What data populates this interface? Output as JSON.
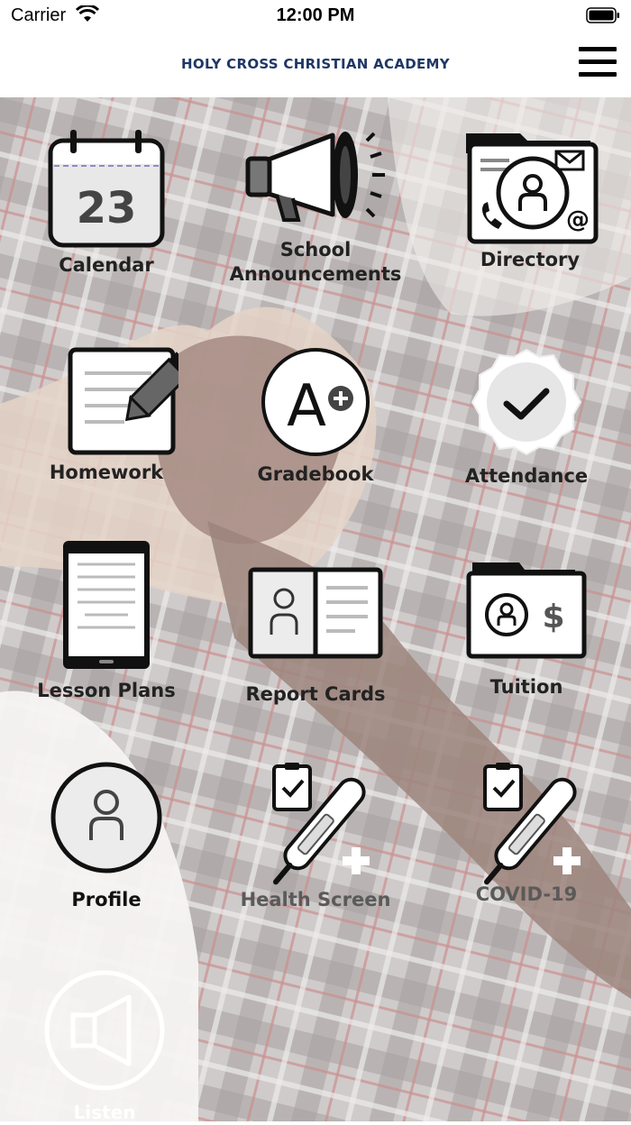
{
  "status_bar": {
    "carrier": "Carrier",
    "time": "12:00 PM"
  },
  "header": {
    "title": "HOLY CROSS CHRISTIAN ACADEMY"
  },
  "tiles": [
    {
      "label": "Calendar",
      "icon": "calendar-icon",
      "calendar_day": "23"
    },
    {
      "label": "School\nAnnouncements",
      "icon": "megaphone-icon"
    },
    {
      "label": "Directory",
      "icon": "directory-card-icon"
    },
    {
      "label": "Homework",
      "icon": "homework-icon"
    },
    {
      "label": "Gradebook",
      "icon": "grade-a-plus-icon",
      "grade_text": "A"
    },
    {
      "label": "Attendance",
      "icon": "checkmark-badge-icon"
    },
    {
      "label": "Lesson Plans",
      "icon": "tablet-icon"
    },
    {
      "label": "Report Cards",
      "icon": "report-book-icon"
    },
    {
      "label": "Tuition",
      "icon": "tuition-folder-icon"
    },
    {
      "label": "Profile",
      "icon": "profile-icon"
    },
    {
      "label": "Health Screen",
      "icon": "thermometer-clipboard-icon"
    },
    {
      "label": "COVID-19",
      "icon": "thermometer-clipboard-icon"
    }
  ],
  "listen": {
    "label": "Listen",
    "icon": "speaker-icon"
  }
}
